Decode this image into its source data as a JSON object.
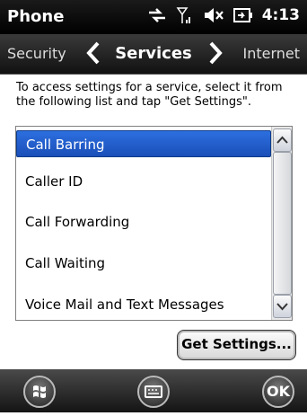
{
  "status_bar": {
    "app_title": "Phone",
    "time": "4:13"
  },
  "tabs": {
    "previous": "Security",
    "current": "Services",
    "next": "Internet"
  },
  "instruction": "To access settings for a service, select it from the following list and tap \"Get Settings\".",
  "services": [
    {
      "label": "Call Barring",
      "selected": true
    },
    {
      "label": "Caller ID",
      "selected": false
    },
    {
      "label": "Call Forwarding",
      "selected": false
    },
    {
      "label": "Call Waiting",
      "selected": false
    },
    {
      "label": "Voice Mail and Text Messages",
      "selected": false
    }
  ],
  "buttons": {
    "get_settings": "Get Settings..."
  },
  "softkeys": {
    "right": "OK"
  },
  "icons": {
    "start": "windows-flag-icon",
    "keyboard": "keyboard-icon",
    "connectivity": "data-arrows-icon",
    "signal": "signal-icon",
    "volume": "speaker-muted-icon",
    "battery": "battery-charging-icon"
  },
  "colors": {
    "selection": "#2d6fe0",
    "bar": "#111111"
  }
}
